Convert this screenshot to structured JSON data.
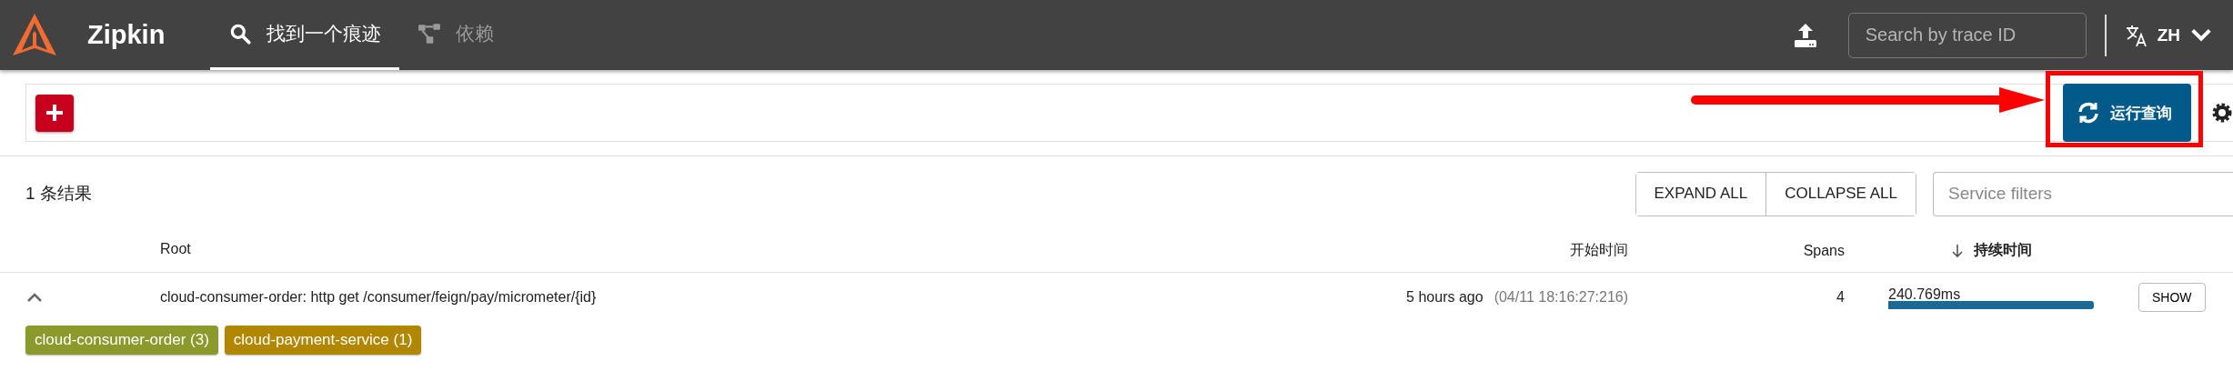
{
  "header": {
    "title": "Zipkin",
    "tabs": [
      {
        "label": "找到一个痕迹",
        "selected": true,
        "kind": "search"
      },
      {
        "label": "依赖",
        "selected": false,
        "kind": "dependencies"
      }
    ],
    "search": {
      "placeholder": "Search by trace ID"
    },
    "language": "ZH"
  },
  "query_bar": {
    "run_button": "运行查询"
  },
  "results": {
    "count": "1 条结果",
    "buttons": [
      "EXPAND ALL",
      "COLLAPSE ALL"
    ],
    "filter": {
      "placeholder": "Service filters"
    },
    "columns": [
      "Root",
      "开始时间",
      "Spans",
      "持续时间"
    ],
    "rows": [
      {
        "expanded": true,
        "root": "cloud-consumer-order: http get /consumer/feign/pay/micrometer/{id}",
        "start_relative": "5 hours ago",
        "start_time": "(04/11 18:16:27:216)",
        "spans": "4",
        "duration": "240.769ms",
        "action": "SHOW",
        "services": [
          {
            "label": "cloud-consumer-order (3)",
            "color": "#8a9a2b"
          },
          {
            "label": "cloud-payment-service (1)",
            "color": "#b28700"
          }
        ]
      }
    ]
  }
}
